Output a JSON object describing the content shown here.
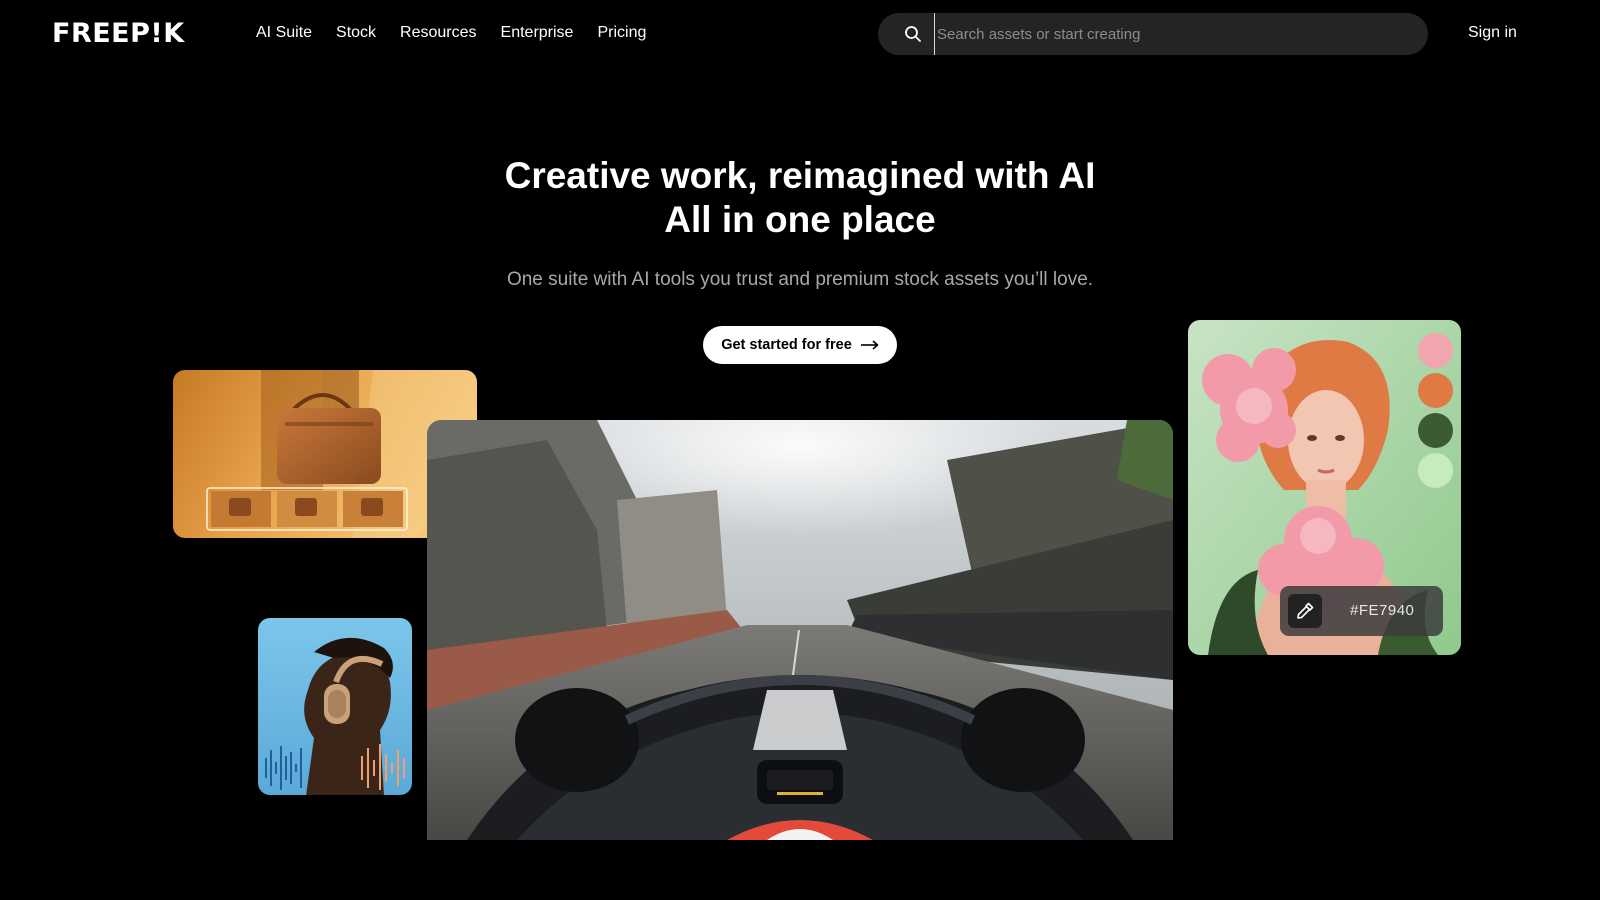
{
  "header": {
    "logo": "FREEP!K",
    "nav": [
      {
        "label": "AI Suite"
      },
      {
        "label": "Stock"
      },
      {
        "label": "Resources"
      },
      {
        "label": "Enterprise"
      },
      {
        "label": "Pricing"
      }
    ],
    "search": {
      "value": "",
      "placeholder": "Search assets or start creating",
      "icon": "search-icon"
    },
    "sign_in": "Sign in"
  },
  "hero": {
    "title_line_1": "Creative work, reimagined with AI",
    "title_line_2": "All in one place",
    "subtitle": "One suite with AI tools you trust and premium stock assets you’ll love.",
    "cta_label": "Get started for free",
    "cta_icon": "arrow-right-icon"
  },
  "showcase": {
    "palette": {
      "swatches": [
        "#F2A5AE",
        "#E07A45",
        "#3C5A33",
        "#C6EBBE"
      ],
      "picker_icon": "eyedropper-icon",
      "selected_color": "#FE7940"
    }
  },
  "colors": {
    "background": "#000000",
    "search_bg": "#242424",
    "cta_bg": "#FFFFFF",
    "subtitle_text": "#A8A8A8"
  }
}
